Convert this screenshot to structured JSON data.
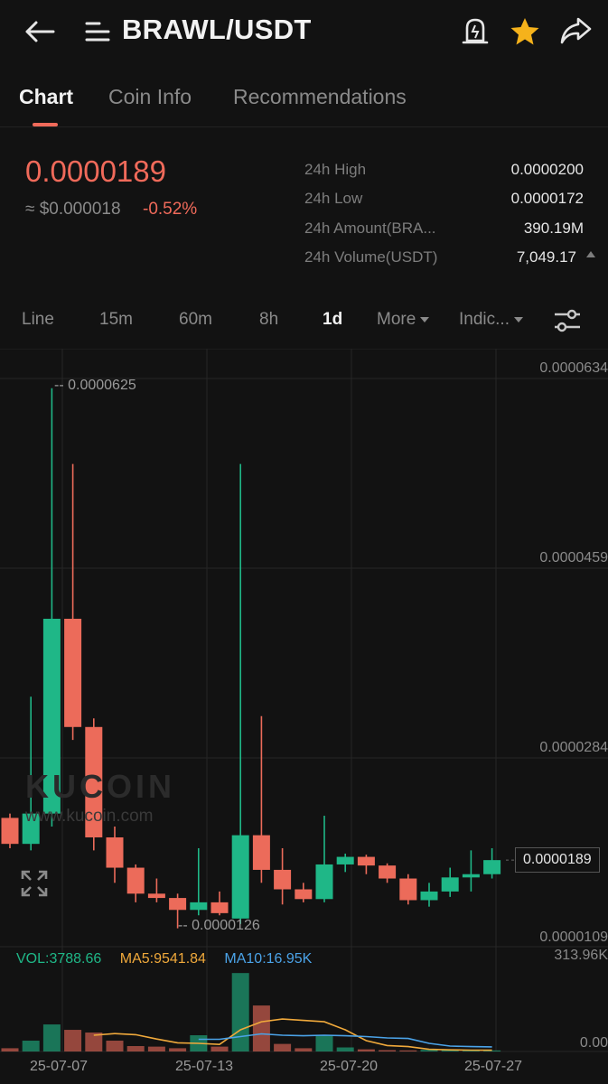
{
  "header": {
    "pair": "BRAWL/USDT",
    "back_icon": "back-arrow-icon",
    "menu_icon": "menu-icon",
    "alert_icon": "alert-bell-icon",
    "favorite_icon": "star-icon",
    "share_icon": "share-icon",
    "favorite_color": "#f5b21b"
  },
  "tabs": [
    "Chart",
    "Coin Info",
    "Recommendations"
  ],
  "ticker": {
    "last_price": "0.0000189",
    "usd_approx": "≈ $0.000018",
    "change_pct": "-0.52%",
    "stats": [
      {
        "label": "24h High",
        "value": "0.0000200"
      },
      {
        "label": "24h Low",
        "value": "0.0000172"
      },
      {
        "label": "24h Amount(BRA...",
        "value": "390.19M"
      },
      {
        "label": "24h Volume(USDT)",
        "value": "7,049.17"
      }
    ]
  },
  "intervals": {
    "items": [
      "Line",
      "15m",
      "60m",
      "8h",
      "1d"
    ],
    "active": "1d",
    "more": "More",
    "indicators": "Indic..."
  },
  "chart_data": {
    "type": "candlestick",
    "price_axis_ticks": [
      "0.0000634",
      "0.0000459",
      "0.0000284",
      "0.0000109"
    ],
    "date_ticks": [
      "25-07-07",
      "25-07-13",
      "25-07-20",
      "25-07-27"
    ],
    "high_label": "0.0000625",
    "low_label": "0.0000126",
    "current_price_label": "0.0000189",
    "volume_axis_ticks": [
      "313.96K",
      "0.00"
    ],
    "volume_indicators": {
      "vol": "VOL:3788.66",
      "ma5": "MA5:9541.84",
      "ma10": "MA10:16.95K"
    },
    "colors": {
      "up": "#1fb787",
      "down": "#ec6b5a",
      "ma5": "#f0a93b",
      "ma10": "#4ba3e8"
    },
    "watermark": "KUCOIN",
    "watermark_url": "www.kucoin.com",
    "candles": [
      {
        "date": "25-07-05",
        "o": 2.28e-05,
        "h": 2.32e-05,
        "l": 2e-05,
        "c": 2.04e-05
      },
      {
        "date": "25-07-06",
        "o": 2.04e-05,
        "h": 3.4e-05,
        "l": 1.98e-05,
        "c": 2.32e-05
      },
      {
        "date": "25-07-07",
        "o": 2.32e-05,
        "h": 6.25e-05,
        "l": 2.2e-05,
        "c": 4.12e-05
      },
      {
        "date": "25-07-08",
        "o": 4.12e-05,
        "h": 5.55e-05,
        "l": 3e-05,
        "c": 3.12e-05
      },
      {
        "date": "25-07-09",
        "o": 3.12e-05,
        "h": 3.2e-05,
        "l": 1.98e-05,
        "c": 2.1e-05
      },
      {
        "date": "25-07-10",
        "o": 2.1e-05,
        "h": 2.2e-05,
        "l": 1.68e-05,
        "c": 1.82e-05
      },
      {
        "date": "25-07-11",
        "o": 1.82e-05,
        "h": 1.85e-05,
        "l": 1.5e-05,
        "c": 1.58e-05
      },
      {
        "date": "25-07-12",
        "o": 1.58e-05,
        "h": 1.72e-05,
        "l": 1.5e-05,
        "c": 1.54e-05
      },
      {
        "date": "25-07-13",
        "o": 1.54e-05,
        "h": 1.58e-05,
        "l": 1.26e-05,
        "c": 1.43e-05
      },
      {
        "date": "25-07-14",
        "o": 1.43e-05,
        "h": 2e-05,
        "l": 1.38e-05,
        "c": 1.5e-05
      },
      {
        "date": "25-07-15",
        "o": 1.5e-05,
        "h": 1.6e-05,
        "l": 1.38e-05,
        "c": 1.4e-05
      },
      {
        "date": "25-07-16",
        "o": 1.35e-05,
        "h": 5.55e-05,
        "l": 1.3e-05,
        "c": 2.12e-05
      },
      {
        "date": "25-07-17",
        "o": 2.12e-05,
        "h": 3.22e-05,
        "l": 1.68e-05,
        "c": 1.8e-05
      },
      {
        "date": "25-07-18",
        "o": 1.8e-05,
        "h": 2e-05,
        "l": 1.48e-05,
        "c": 1.62e-05
      },
      {
        "date": "25-07-19",
        "o": 1.62e-05,
        "h": 1.68e-05,
        "l": 1.5e-05,
        "c": 1.53e-05
      },
      {
        "date": "25-07-20",
        "o": 1.53e-05,
        "h": 2.3e-05,
        "l": 1.5e-05,
        "c": 1.85e-05
      },
      {
        "date": "25-07-21",
        "o": 1.85e-05,
        "h": 1.95e-05,
        "l": 1.78e-05,
        "c": 1.92e-05
      },
      {
        "date": "25-07-22",
        "o": 1.92e-05,
        "h": 1.94e-05,
        "l": 1.76e-05,
        "c": 1.84e-05
      },
      {
        "date": "25-07-23",
        "o": 1.84e-05,
        "h": 1.86e-05,
        "l": 1.68e-05,
        "c": 1.72e-05
      },
      {
        "date": "25-07-24",
        "o": 1.72e-05,
        "h": 1.76e-05,
        "l": 1.48e-05,
        "c": 1.52e-05
      },
      {
        "date": "25-07-25",
        "o": 1.52e-05,
        "h": 1.68e-05,
        "l": 1.46e-05,
        "c": 1.6e-05
      },
      {
        "date": "25-07-26",
        "o": 1.6e-05,
        "h": 1.82e-05,
        "l": 1.55e-05,
        "c": 1.73e-05
      },
      {
        "date": "25-07-27",
        "o": 1.73e-05,
        "h": 1.98e-05,
        "l": 1.6e-05,
        "c": 1.76e-05
      },
      {
        "date": "25-07-28",
        "o": 1.76e-05,
        "h": 2e-05,
        "l": 1.72e-05,
        "c": 1.89e-05
      }
    ],
    "volumes": [
      12000,
      40000,
      100000,
      80000,
      70000,
      40000,
      20000,
      18000,
      12000,
      60000,
      18000,
      290000,
      170000,
      28000,
      12000,
      60000,
      15000,
      8000,
      5000,
      4000,
      6000,
      5000,
      4000,
      3788
    ],
    "ma5": [
      null,
      null,
      null,
      null,
      60000,
      66000,
      62000,
      46000,
      32000,
      30000,
      26000,
      80000,
      110000,
      120000,
      115000,
      110000,
      80000,
      40000,
      22000,
      18000,
      8000,
      6000,
      5000,
      4800
    ],
    "ma10": [
      null,
      null,
      null,
      null,
      null,
      null,
      null,
      null,
      null,
      45000,
      45000,
      55000,
      65000,
      60000,
      58000,
      60000,
      58000,
      55000,
      50000,
      48000,
      30000,
      20000,
      18000,
      16950
    ]
  }
}
